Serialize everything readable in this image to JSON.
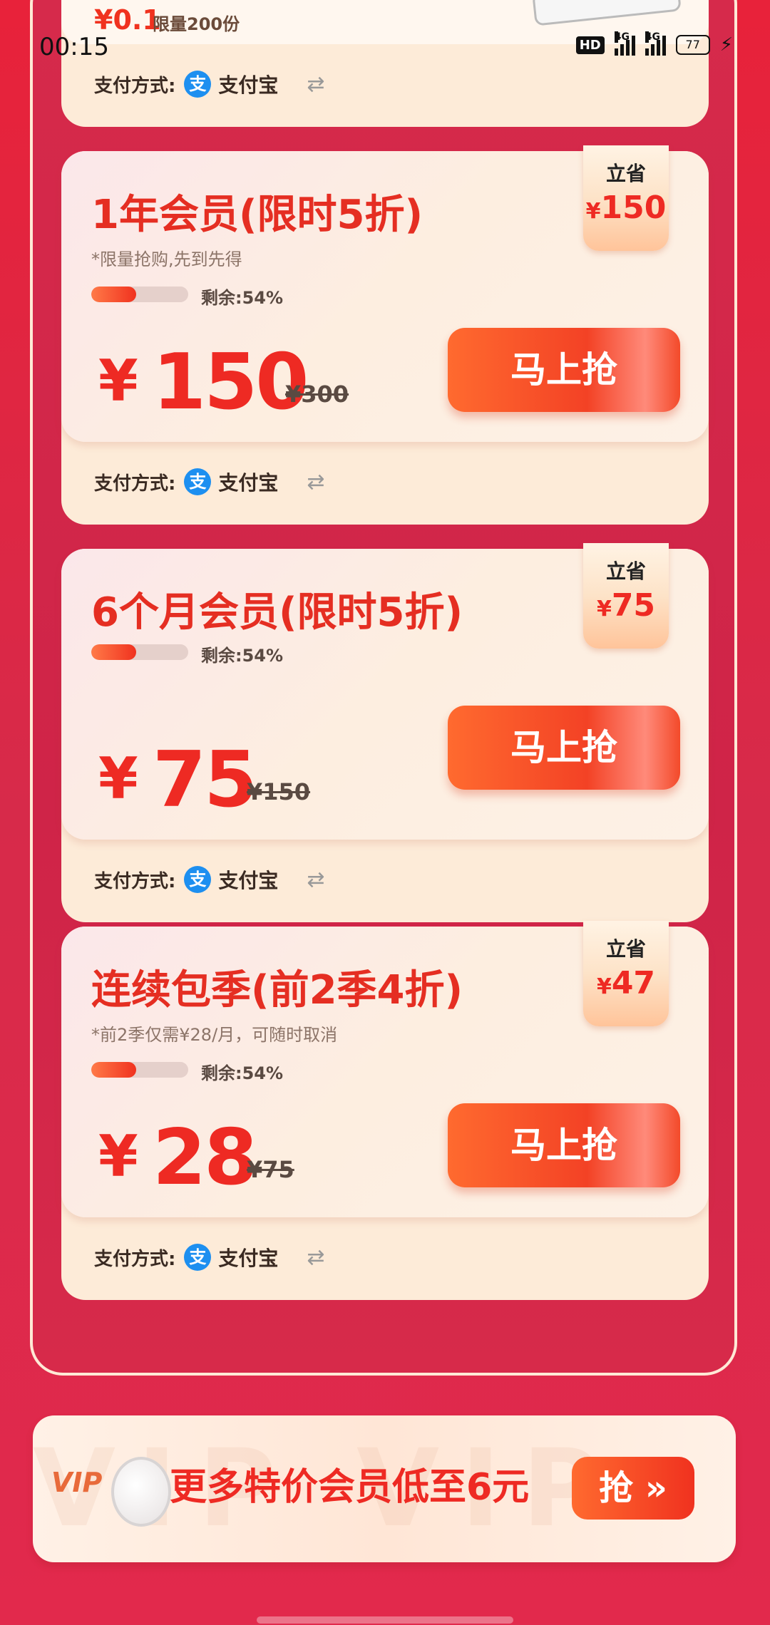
{
  "status_bar": {
    "time": "00:15",
    "hd_label": "HD",
    "network1": "4G",
    "network2": "4G",
    "battery": "77"
  },
  "top_card": {
    "price": "¥0.1",
    "limit": "限量200份",
    "pay_label": "支付方式:",
    "pay_method": "支付宝"
  },
  "offers": [
    {
      "title": "1年会员(限时5折)",
      "note": "*限量抢购,先到先得",
      "remaining": "剩余:54%",
      "progress": 0.46,
      "currency": "¥",
      "price": "150",
      "original_price": "¥300",
      "button": "马上抢",
      "save_label": "立省",
      "save_currency": "¥",
      "save_amount": "150",
      "pay_label": "支付方式:",
      "pay_method": "支付宝"
    },
    {
      "title": "6个月会员(限时5折)",
      "note": "",
      "remaining": "剩余:54%",
      "progress": 0.46,
      "currency": "¥",
      "price": "75",
      "original_price": "¥150",
      "button": "马上抢",
      "save_label": "立省",
      "save_currency": "¥",
      "save_amount": "75",
      "pay_label": "支付方式:",
      "pay_method": "支付宝"
    },
    {
      "title": "连续包季(前2季4折)",
      "note": "*前2季仅需¥28/月，可随时取消",
      "remaining": "剩余:54%",
      "progress": 0.46,
      "currency": "¥",
      "price": "28",
      "original_price": "¥75",
      "button": "马上抢",
      "save_label": "立省",
      "save_currency": "¥",
      "save_amount": "47",
      "pay_label": "支付方式:",
      "pay_method": "支付宝"
    }
  ],
  "banner": {
    "watermark": "VIP VIP",
    "vip_label": "VIP",
    "text": "更多特价会员低至6元",
    "button": "抢 »"
  },
  "icons": {
    "alipay": "alipay-icon",
    "swap": "swap-icon",
    "bolt": "charging-bolt-icon"
  },
  "colors": {
    "accent_red": "#ee2a23",
    "button_orange": "#ff6a2f",
    "card_bg": "#fdebd8",
    "alipay_blue": "#1d8ff0"
  }
}
